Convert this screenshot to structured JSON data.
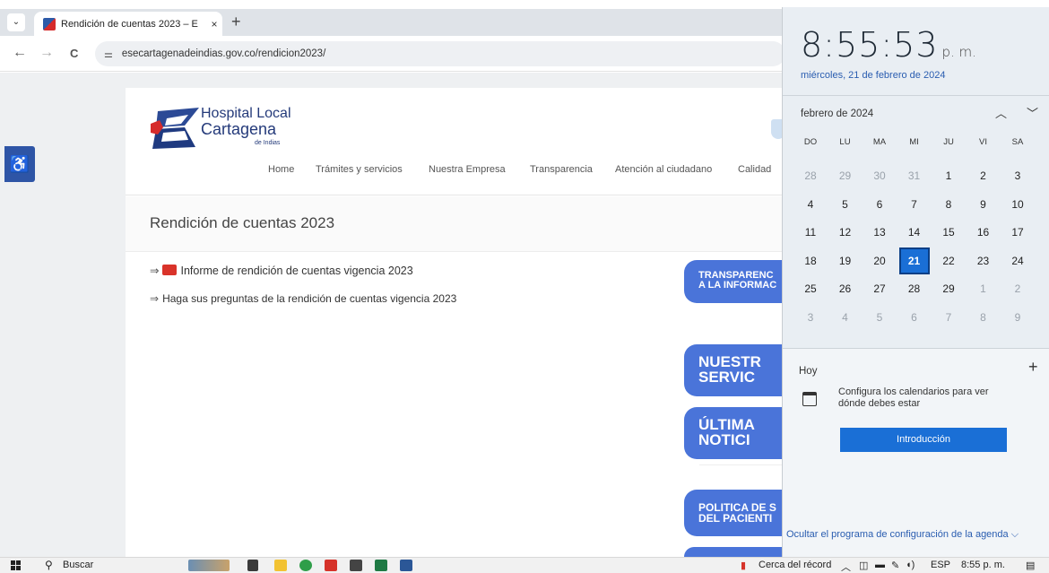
{
  "browser": {
    "tab_title": "Rendición de cuentas 2023 – E",
    "tab_close": "×",
    "new_tab": "+",
    "tab_menu": "⌄",
    "back": "←",
    "forward": "→",
    "reload": "C",
    "url": "esecartagenadeindias.gov.co/rendicion2023/"
  },
  "site": {
    "logo_line1": "Hospital Local",
    "logo_line2": "Cartagena",
    "logo_line3": "de Indias",
    "menu": [
      "Home",
      "Trámites y servicios",
      "Nuestra Empresa",
      "Transparencia",
      "Atención al ciudadano",
      "Calidad"
    ],
    "page_title": "Rendición de cuentas 2023",
    "links": [
      {
        "arrow": "⇒",
        "label": "Informe de rendición de cuentas vigencia 2023",
        "pdf": true
      },
      {
        "arrow": "⇒",
        "label": "Haga sus preguntas de la rendición de cuentas vigencia 2023",
        "pdf": false
      }
    ],
    "banners": [
      {
        "line1": "TRANSPARENC",
        "line2": "A LA INFORMAC"
      },
      {
        "line1": "NUESTR",
        "line2": "SERVIC"
      },
      {
        "line1": "ÚLTIMA",
        "line2": "NOTICI"
      },
      {
        "line1": "POLITICA DE S",
        "line2": "DEL PACIENTI"
      }
    ]
  },
  "flyout": {
    "time": "8:55:53",
    "ampm": "p. m.",
    "date_long": "miércoles, 21 de febrero de 2024",
    "month_label": "febrero de 2024",
    "chev_up": "︿",
    "chev_down": "﹀",
    "weekdays": [
      "DO",
      "LU",
      "MA",
      "MI",
      "JU",
      "VI",
      "SA"
    ],
    "days": [
      [
        "28",
        "29",
        "30",
        "31",
        "1",
        "2",
        "3"
      ],
      [
        "4",
        "5",
        "6",
        "7",
        "8",
        "9",
        "10"
      ],
      [
        "11",
        "12",
        "13",
        "14",
        "15",
        "16",
        "17"
      ],
      [
        "18",
        "19",
        "20",
        "21",
        "22",
        "23",
        "24"
      ],
      [
        "25",
        "26",
        "27",
        "28",
        "29",
        "1",
        "2"
      ],
      [
        "3",
        "4",
        "5",
        "6",
        "7",
        "8",
        "9"
      ]
    ],
    "today": "21",
    "hoy": "Hoy",
    "plus": "+",
    "config_text": "Configura los calendarios para ver dónde debes estar",
    "intro_button": "Introducción",
    "hide_link": "Ocultar el programa de configuración de la agenda ⌵"
  },
  "taskbar": {
    "search_placeholder": "Buscar",
    "weather": "Cerca del récord",
    "language": "ESP",
    "time": "8:55 p. m."
  },
  "colors": {
    "accent": "#1a6fd6",
    "banner": "#4a74d9",
    "brand": "#243a7a"
  }
}
